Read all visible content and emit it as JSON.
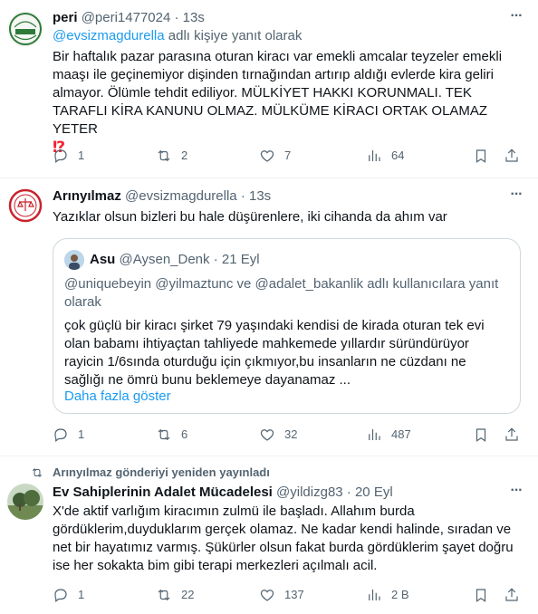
{
  "tweets": [
    {
      "author": "peri",
      "handle": "@peri1477024",
      "time": "13s",
      "reply_mention": "@evsizmagdurella",
      "reply_suffix": " adlı kişiye yanıt olarak",
      "text": "Bir haftalık pazar parasına oturan kiracı var emekli amcalar teyzeler emekli maaşı ile geçinemiyor dişinden tırnağından artırıp aldığı evlerde kira geliri almayor. Ölümle tehdit ediliyor. MÜLKİYET HAKKI KORUNMALI. TEK TARAFLI KİRA KANUNU OLMAZ. MÜLKÜME KİRACI ORTAK OLAMAZ YETER",
      "text_emphasis": "⁉",
      "stats": {
        "replies": "1",
        "retweets": "2",
        "likes": "7",
        "views": "64"
      }
    },
    {
      "author": "Arınyılmaz",
      "handle": "@evsizmagdurella",
      "time": "13s",
      "text": "Yazıklar olsun bizleri bu hale düşürenlere, iki cihanda da ahım var",
      "quote": {
        "author": "Asu",
        "handle": "@Aysen_Denk",
        "time": "21 Eyl",
        "reply_line": "@uniquebeyin @yilmaztunc ve @adalet_bakanlik adlı kullanıcılara yanıt olarak",
        "text": "çok güçlü bir kiracı şirket 79 yaşındaki kendisi de kirada oturan tek evi olan babamı ihtiyaçtan tahliyede mahkemede yıllardır süründürüyor rayicin 1/6sında oturduğu için çıkmıyor,bu insanların ne cüzdanı ne sağlığı ne ömrü bunu beklemeye dayanamaz ...",
        "show_more": "Daha fazla göster"
      },
      "stats": {
        "replies": "1",
        "retweets": "6",
        "likes": "32",
        "views": "487"
      }
    },
    {
      "retweeted_by": "Arınyılmaz gönderiyi yeniden yayınladı",
      "author": "Ev Sahiplerinin Adalet Mücadelesi",
      "handle": "@yildizg83",
      "time": "20 Eyl",
      "text": "X'de aktif varlığım kiracımın zulmü ile başladı. Allahım burda gördüklerim,duyduklarım gerçek olamaz. Ne kadar kendi halinde, sıradan ve net bir hayatımız varmış. Şükürler olsun fakat burda gördüklerim şayet doğru ise her sokakta bim gibi terapi merkezleri açılmalı acil.",
      "stats": {
        "replies": "1",
        "retweets": "22",
        "likes": "137",
        "views": "2 B"
      }
    }
  ],
  "separator": "·",
  "colors": {
    "text": "#0f1419",
    "secondary": "#536471",
    "link": "#1d9bf0",
    "border": "#eff3f4"
  }
}
